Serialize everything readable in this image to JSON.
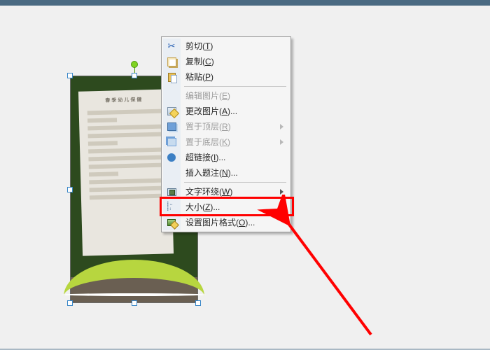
{
  "document_thumb": {
    "title_text": "春季幼儿保健"
  },
  "menu": {
    "cut": {
      "label": "剪切",
      "hotkey": "T"
    },
    "copy": {
      "label": "复制",
      "hotkey": "C"
    },
    "paste": {
      "label": "粘贴",
      "hotkey": "P"
    },
    "edit_image": {
      "label": "编辑图片",
      "hotkey": "E"
    },
    "change_img": {
      "label": "更改图片",
      "hotkey": "A",
      "suffix": "..."
    },
    "bring_front": {
      "label": "置于顶层",
      "hotkey": "R"
    },
    "send_back": {
      "label": "置于底层",
      "hotkey": "K"
    },
    "hyperlink": {
      "label": "超链接",
      "hotkey": "I",
      "suffix": "..."
    },
    "caption": {
      "label": "插入题注",
      "hotkey": "N",
      "suffix": "..."
    },
    "text_wrap": {
      "label": "文字环绕",
      "hotkey": "W"
    },
    "size": {
      "label": "大小",
      "hotkey": "Z",
      "suffix": "..."
    },
    "format": {
      "label": "设置图片格式",
      "hotkey": "O",
      "suffix": "..."
    }
  }
}
